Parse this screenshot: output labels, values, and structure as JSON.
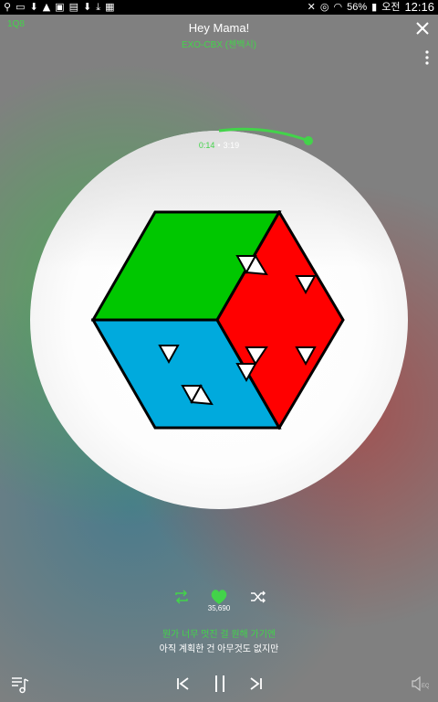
{
  "status_bar": {
    "battery": "56%",
    "ampm": "오전",
    "time": "12:16"
  },
  "header": {
    "title": "Hey Mama!",
    "artist": "EXO-CBX (첸백시)",
    "top_left_label": "1Q8"
  },
  "player": {
    "current_time": "0:14",
    "total_time": "3:19",
    "progress": 0.07,
    "like_count": "35,690",
    "liked": true
  },
  "lyrics": {
    "current": "뭔가 너무 멋진 걸 원해 가기엔",
    "next": "아직 계획한 건 아무것도 없지만"
  },
  "colors": {
    "accent": "#43d34a",
    "cover_green": "#00c700",
    "cover_red": "#ff0000",
    "cover_blue": "#00aadd"
  },
  "icons": {
    "close": "close-icon",
    "more": "more-vertical-icon",
    "repeat": "repeat-icon",
    "heart": "heart-icon",
    "shuffle": "shuffle-icon",
    "playlist": "playlist-icon",
    "prev": "skip-previous-icon",
    "pause": "pause-icon",
    "next": "skip-next-icon",
    "eq": "equalizer-icon"
  }
}
